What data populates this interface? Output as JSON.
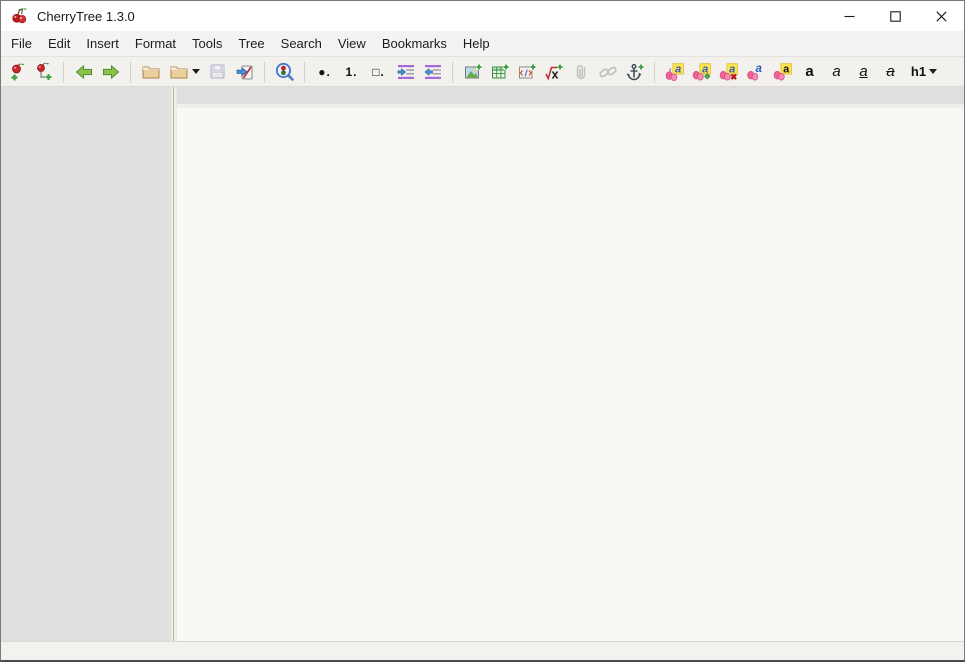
{
  "window": {
    "title": "CherryTree 1.3.0",
    "controls": [
      "minimize-icon",
      "maximize-icon",
      "close-icon"
    ]
  },
  "menu": {
    "items": [
      "File",
      "Edit",
      "Insert",
      "Format",
      "Tools",
      "Tree",
      "Search",
      "View",
      "Bookmarks",
      "Help"
    ]
  },
  "toolbar": {
    "glyphs": {
      "bullet": "●.",
      "numbered": "1.",
      "todo": "□.",
      "bold": "a",
      "italic": "a",
      "underline": "a",
      "strikethrough": "a",
      "heading": "h1"
    },
    "icons": [
      "new-node",
      "new-subnode",
      "go-back",
      "go-forward",
      "open-file",
      "open-recent-dropdown",
      "save",
      "save-as",
      "find-node",
      "bullet-list",
      "numbered-list",
      "todo-list",
      "indent",
      "unindent",
      "insert-image",
      "insert-table",
      "insert-codebox",
      "insert-formula",
      "attach-file",
      "insert-link",
      "insert-anchor",
      "apply-latest-format",
      "format-text",
      "remove-format",
      "text-color",
      "highlight-color",
      "bold",
      "italic",
      "underline",
      "strikethrough",
      "heading-dropdown"
    ],
    "disabled_icons": [
      "save",
      "attach-file",
      "insert-link"
    ]
  },
  "statusbar": {
    "text": ""
  },
  "colors": {
    "titlebar": "#ffffff",
    "menubar": "#f4f3f1",
    "toolbar": "#f2f1ee",
    "tree_panel": "#e0e0e0",
    "editor_header": "#dfdfdf",
    "editor_bg": "#f9f8f5",
    "statusbar_bg": "#f3f2ef",
    "window_border": "#787878",
    "accent_green": "#43a047",
    "cherry_red": "#c62828",
    "format_pink": "#f06292",
    "highlight_yellow": "#ffe24d"
  }
}
